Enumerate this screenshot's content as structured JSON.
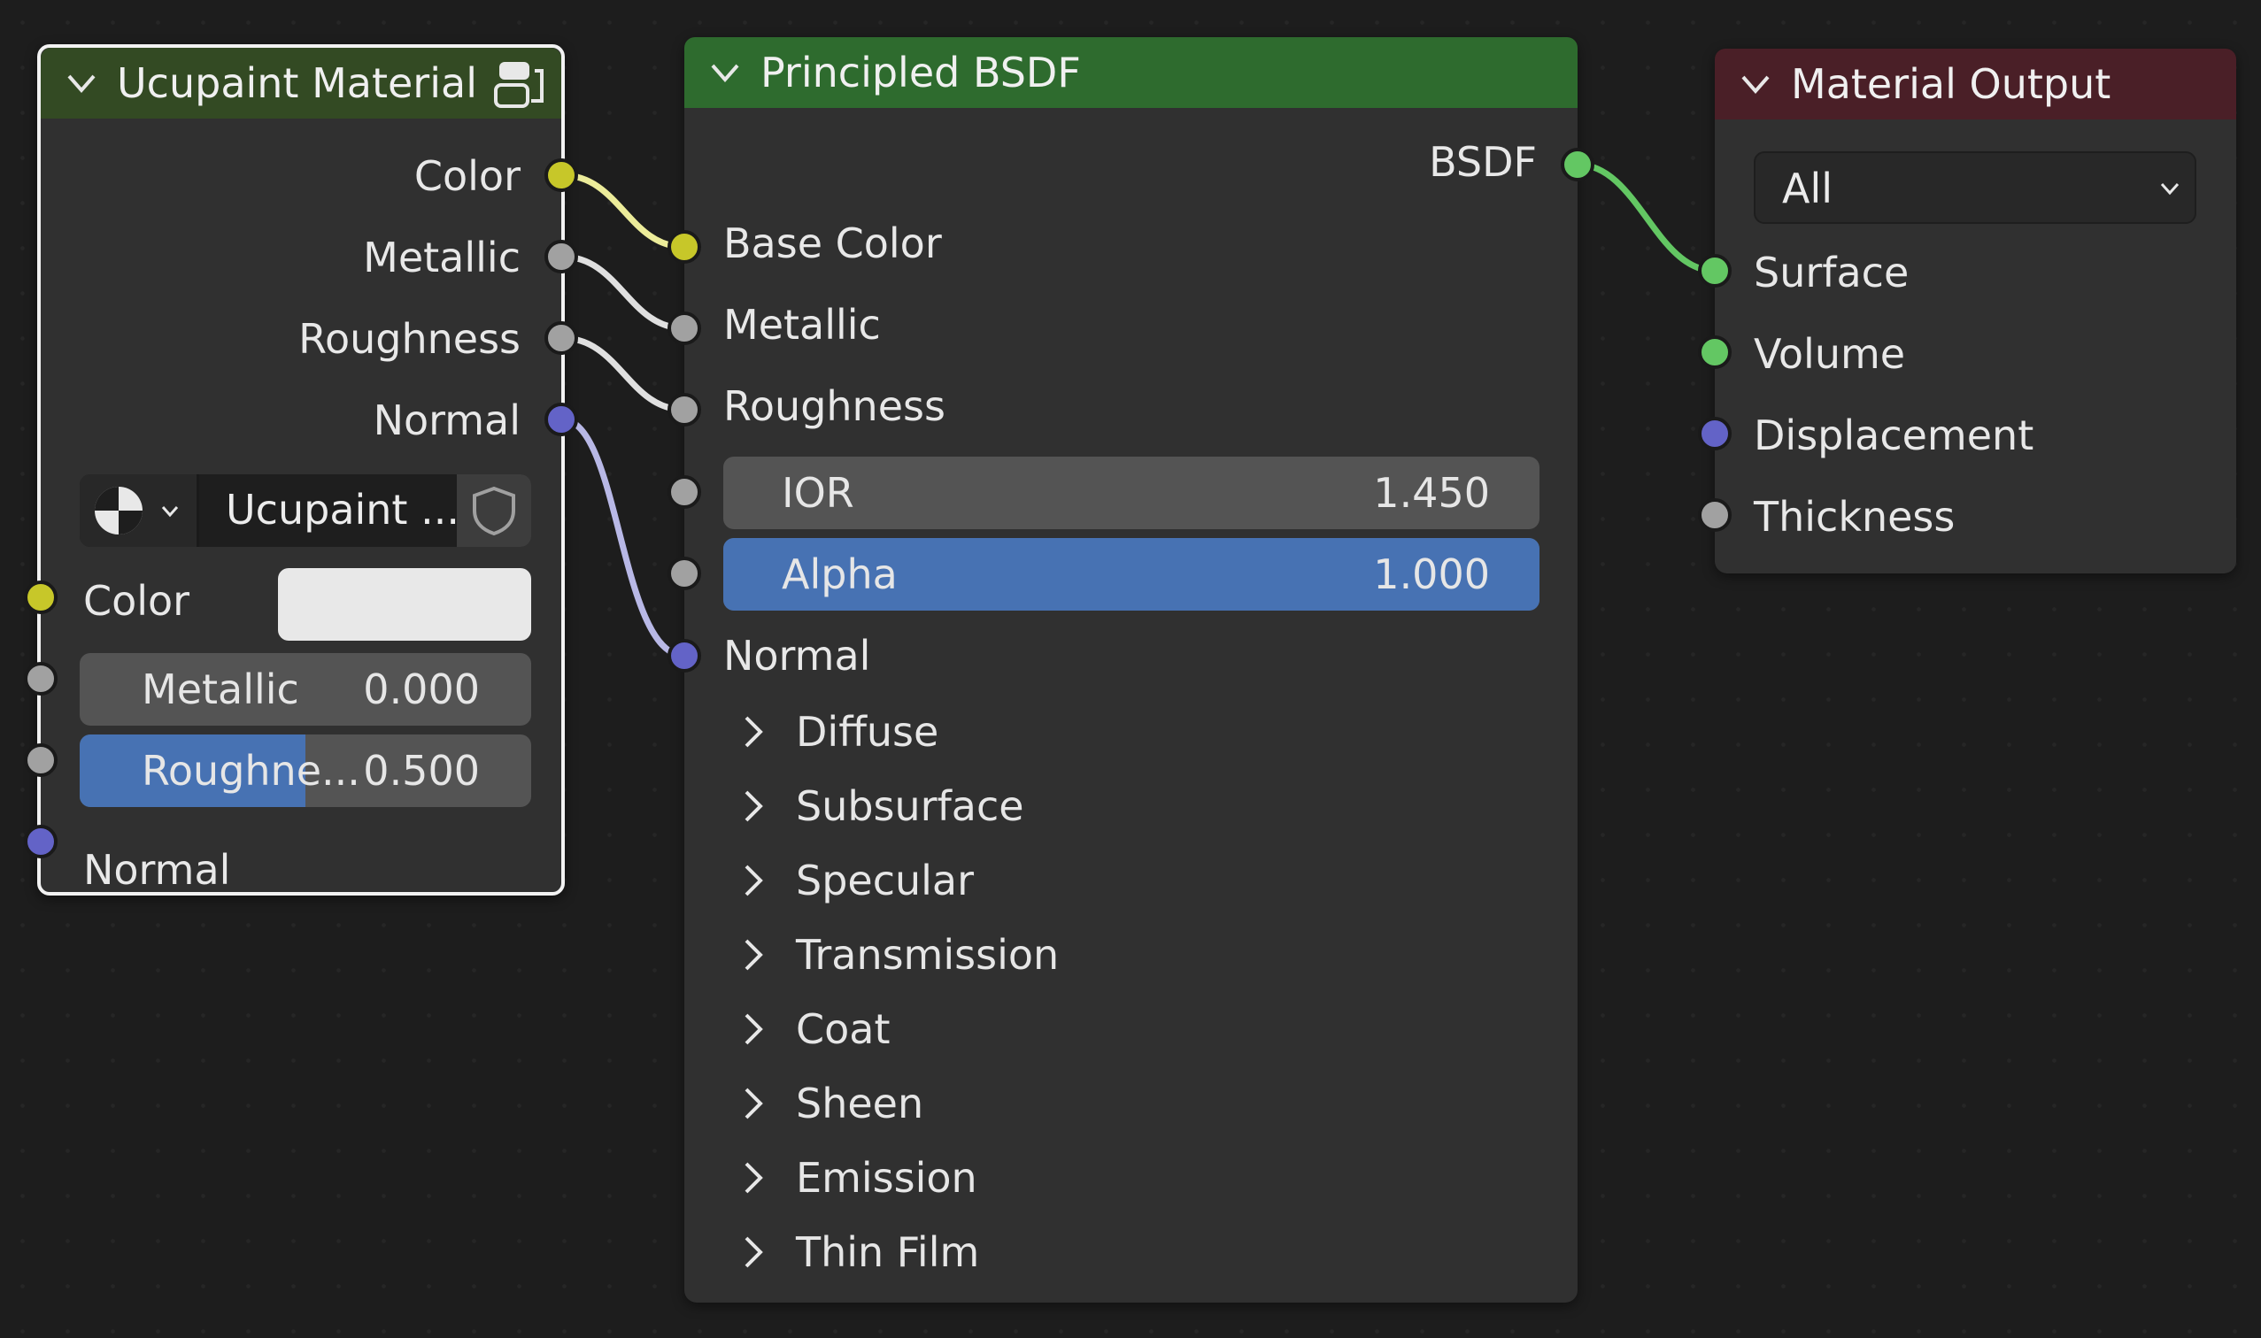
{
  "colors": {
    "accent_blue": "#4772b3",
    "header_green_dark": "#334a23",
    "header_green": "#2e6b2e",
    "header_red": "#4a1f27",
    "socket_yellow": "#c7c729",
    "socket_gray": "#a1a1a1",
    "socket_blue": "#6363c7",
    "socket_green": "#63c763"
  },
  "ucupaint_node": {
    "title": "Ucupaint Material",
    "header_icon": "node-group-icon",
    "outputs": [
      "Color",
      "Metallic",
      "Roughness",
      "Normal"
    ],
    "datablock_name": "Ucupaint ...",
    "datablock_icon": "material-sphere-icon",
    "fake_user_icon": "shield-icon",
    "input_color_label": "Color",
    "input_color_value": "#e8e8e8",
    "metallic_label": "Metallic",
    "metallic_value": "0.000",
    "roughness_label": "Roughne...",
    "roughness_value": "0.500",
    "roughness_fraction": 0.5,
    "normal_label": "Normal"
  },
  "bsdf_node": {
    "title": "Principled BSDF",
    "output": "BSDF",
    "inputs": [
      "Base Color",
      "Metallic",
      "Roughness"
    ],
    "ior_label": "IOR",
    "ior_value": "1.450",
    "alpha_label": "Alpha",
    "alpha_value": "1.000",
    "alpha_fraction": 1.0,
    "normal_label": "Normal",
    "panels": [
      "Diffuse",
      "Subsurface",
      "Specular",
      "Transmission",
      "Coat",
      "Sheen",
      "Emission",
      "Thin Film"
    ]
  },
  "output_node": {
    "title": "Material Output",
    "target": "All",
    "inputs": [
      "Surface",
      "Volume",
      "Displacement",
      "Thickness"
    ]
  }
}
